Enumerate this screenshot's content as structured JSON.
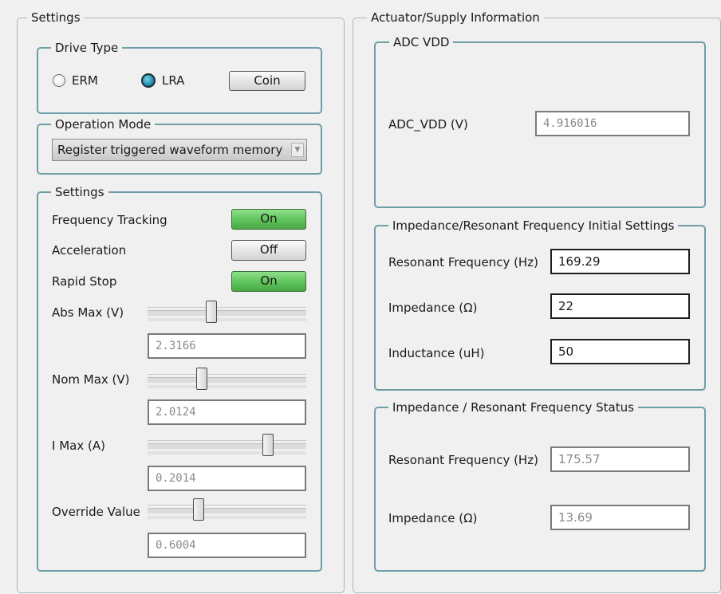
{
  "settings": {
    "title": "Settings",
    "drive_type": {
      "title": "Drive Type",
      "options": [
        {
          "label": "ERM",
          "selected": false
        },
        {
          "label": "LRA",
          "selected": true
        }
      ],
      "coin_button": "Coin"
    },
    "operation_mode": {
      "title": "Operation Mode",
      "selected": "Register triggered waveform memory"
    },
    "inner": {
      "title": "Settings",
      "frequency_tracking": {
        "label": "Frequency Tracking",
        "state": "On"
      },
      "acceleration": {
        "label": "Acceleration",
        "state": "Off"
      },
      "rapid_stop": {
        "label": "Rapid Stop",
        "state": "On"
      },
      "abs_max": {
        "label": "Abs Max (V)",
        "value": "2.3166",
        "slider_fraction": 0.4
      },
      "nom_max": {
        "label": "Nom Max (V)",
        "value": "2.0124",
        "slider_fraction": 0.34
      },
      "i_max": {
        "label": "I Max (A)",
        "value": "0.2014",
        "slider_fraction": 0.76
      },
      "override": {
        "label": "Override Value",
        "value": "0.6004",
        "slider_fraction": 0.32
      }
    }
  },
  "actuator": {
    "title": "Actuator/Supply Information",
    "adc": {
      "title": "ADC VDD",
      "label": "ADC_VDD (V)",
      "value": "4.916016"
    },
    "initial": {
      "title": "Impedance/Resonant Frequency Initial Settings",
      "resonant_label": "Resonant Frequency (Hz)",
      "resonant_value": "169.29",
      "impedance_label": "Impedance (Ω)",
      "impedance_value": "22",
      "inductance_label": "Inductance (uH)",
      "inductance_value": "50"
    },
    "status": {
      "title": "Impedance / Resonant Frequency Status",
      "resonant_label": "Resonant Frequency (Hz)",
      "resonant_value": "175.57",
      "impedance_label": "Impedance (Ω)",
      "impedance_value": "13.69"
    }
  },
  "colors": {
    "on_button": "#5ec25a",
    "selected_radio": "#1d8fb0",
    "group_border": "#6e9ea8"
  }
}
